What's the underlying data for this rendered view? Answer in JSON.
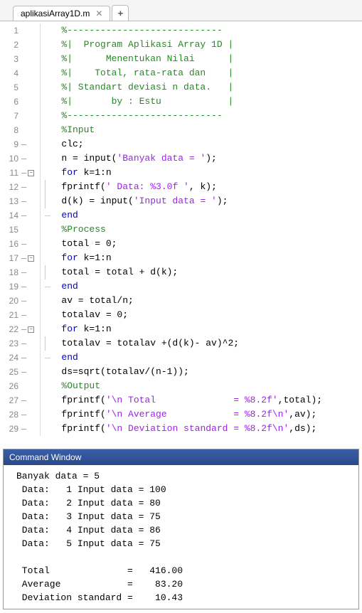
{
  "tab": {
    "title": "aplikasiArray1D.m"
  },
  "editor": {
    "lines": [
      {
        "n": 1,
        "gutter": "",
        "tokens": [
          {
            "cls": "cmt",
            "t": "   %----------------------------"
          }
        ]
      },
      {
        "n": 2,
        "gutter": "",
        "tokens": [
          {
            "cls": "cmt",
            "t": "   %|  Program Aplikasi Array 1D |"
          }
        ]
      },
      {
        "n": 3,
        "gutter": "",
        "tokens": [
          {
            "cls": "cmt",
            "t": "   %|      Menentukan Nilai      |"
          }
        ]
      },
      {
        "n": 4,
        "gutter": "",
        "tokens": [
          {
            "cls": "cmt",
            "t": "   %|    Total, rata-rata dan    |"
          }
        ]
      },
      {
        "n": 5,
        "gutter": "",
        "tokens": [
          {
            "cls": "cmt",
            "t": "   %| Standart deviasi n data.   |"
          }
        ]
      },
      {
        "n": 6,
        "gutter": "",
        "tokens": [
          {
            "cls": "cmt",
            "t": "   %|       by : Estu            |"
          }
        ]
      },
      {
        "n": 7,
        "gutter": "",
        "tokens": [
          {
            "cls": "cmt",
            "t": "   %----------------------------"
          }
        ]
      },
      {
        "n": 8,
        "gutter": "",
        "tokens": [
          {
            "cls": "cmt",
            "t": "   %Input"
          }
        ]
      },
      {
        "n": 9,
        "gutter": "dash",
        "tokens": [
          {
            "cls": "txt",
            "t": "   clc;"
          }
        ]
      },
      {
        "n": 10,
        "gutter": "dash",
        "tokens": [
          {
            "cls": "txt",
            "t": "   n = input("
          },
          {
            "cls": "str",
            "t": "'Banyak data = '"
          },
          {
            "cls": "txt",
            "t": ");"
          }
        ]
      },
      {
        "n": 11,
        "gutter": "fold",
        "tokens": [
          {
            "cls": "kw",
            "t": "   for"
          },
          {
            "cls": "txt",
            "t": " k=1:n"
          }
        ]
      },
      {
        "n": 12,
        "gutter": "dash",
        "guide": true,
        "tokens": [
          {
            "cls": "txt",
            "t": "   fprintf("
          },
          {
            "cls": "str",
            "t": "' Data: %3.0f '"
          },
          {
            "cls": "txt",
            "t": ", k);"
          }
        ]
      },
      {
        "n": 13,
        "gutter": "dash",
        "guide": true,
        "tokens": [
          {
            "cls": "txt",
            "t": "   d(k) = input("
          },
          {
            "cls": "str",
            "t": "'Input data = '"
          },
          {
            "cls": "txt",
            "t": ");"
          }
        ]
      },
      {
        "n": 14,
        "gutter": "dash",
        "guide2": true,
        "tokens": [
          {
            "cls": "kw",
            "t": "   end"
          }
        ]
      },
      {
        "n": 15,
        "gutter": "",
        "tokens": [
          {
            "cls": "cmt",
            "t": "   %Process"
          }
        ]
      },
      {
        "n": 16,
        "gutter": "dash",
        "tokens": [
          {
            "cls": "txt",
            "t": "   total = 0;"
          }
        ]
      },
      {
        "n": 17,
        "gutter": "fold",
        "tokens": [
          {
            "cls": "kw",
            "t": "   for"
          },
          {
            "cls": "txt",
            "t": " k=1:n"
          }
        ]
      },
      {
        "n": 18,
        "gutter": "dash",
        "guide": true,
        "tokens": [
          {
            "cls": "txt",
            "t": "   total = total + d(k);"
          }
        ]
      },
      {
        "n": 19,
        "gutter": "dash",
        "guide2": true,
        "tokens": [
          {
            "cls": "kw",
            "t": "   end"
          }
        ]
      },
      {
        "n": 20,
        "gutter": "dash",
        "tokens": [
          {
            "cls": "txt",
            "t": "   av = total/n;"
          }
        ]
      },
      {
        "n": 21,
        "gutter": "dash",
        "tokens": [
          {
            "cls": "txt",
            "t": "   totalav = 0;"
          }
        ]
      },
      {
        "n": 22,
        "gutter": "fold",
        "tokens": [
          {
            "cls": "kw",
            "t": "   for"
          },
          {
            "cls": "txt",
            "t": " k=1:n"
          }
        ]
      },
      {
        "n": 23,
        "gutter": "dash",
        "guide": true,
        "tokens": [
          {
            "cls": "txt",
            "t": "   totalav = totalav +(d(k)- av)^2;"
          }
        ]
      },
      {
        "n": 24,
        "gutter": "dash",
        "guide2": true,
        "tokens": [
          {
            "cls": "kw",
            "t": "   end"
          }
        ]
      },
      {
        "n": 25,
        "gutter": "dash",
        "tokens": [
          {
            "cls": "txt",
            "t": "   ds=sqrt(totalav/(n-1));"
          }
        ]
      },
      {
        "n": 26,
        "gutter": "",
        "tokens": [
          {
            "cls": "cmt",
            "t": "   %Output"
          }
        ]
      },
      {
        "n": 27,
        "gutter": "dash",
        "tokens": [
          {
            "cls": "txt",
            "t": "   fprintf("
          },
          {
            "cls": "str",
            "t": "'\\n Total              = %8.2f'"
          },
          {
            "cls": "txt",
            "t": ",total);"
          }
        ]
      },
      {
        "n": 28,
        "gutter": "dash",
        "tokens": [
          {
            "cls": "txt",
            "t": "   fprintf("
          },
          {
            "cls": "str",
            "t": "'\\n Average            = %8.2f\\n'"
          },
          {
            "cls": "txt",
            "t": ",av);"
          }
        ]
      },
      {
        "n": 29,
        "gutter": "dash",
        "tokens": [
          {
            "cls": "txt",
            "t": "   fprintf("
          },
          {
            "cls": "str",
            "t": "'\\n Deviation standard = %8.2f\\n'"
          },
          {
            "cls": "txt",
            "t": ",ds);"
          }
        ]
      }
    ]
  },
  "cmd": {
    "title": "Command Window",
    "body": "Banyak data = 5\n Data:   1 Input data = 100\n Data:   2 Input data = 80\n Data:   3 Input data = 75\n Data:   4 Input data = 86\n Data:   5 Input data = 75\n\n Total              =   416.00\n Average            =    83.20\n Deviation standard =    10.43"
  }
}
